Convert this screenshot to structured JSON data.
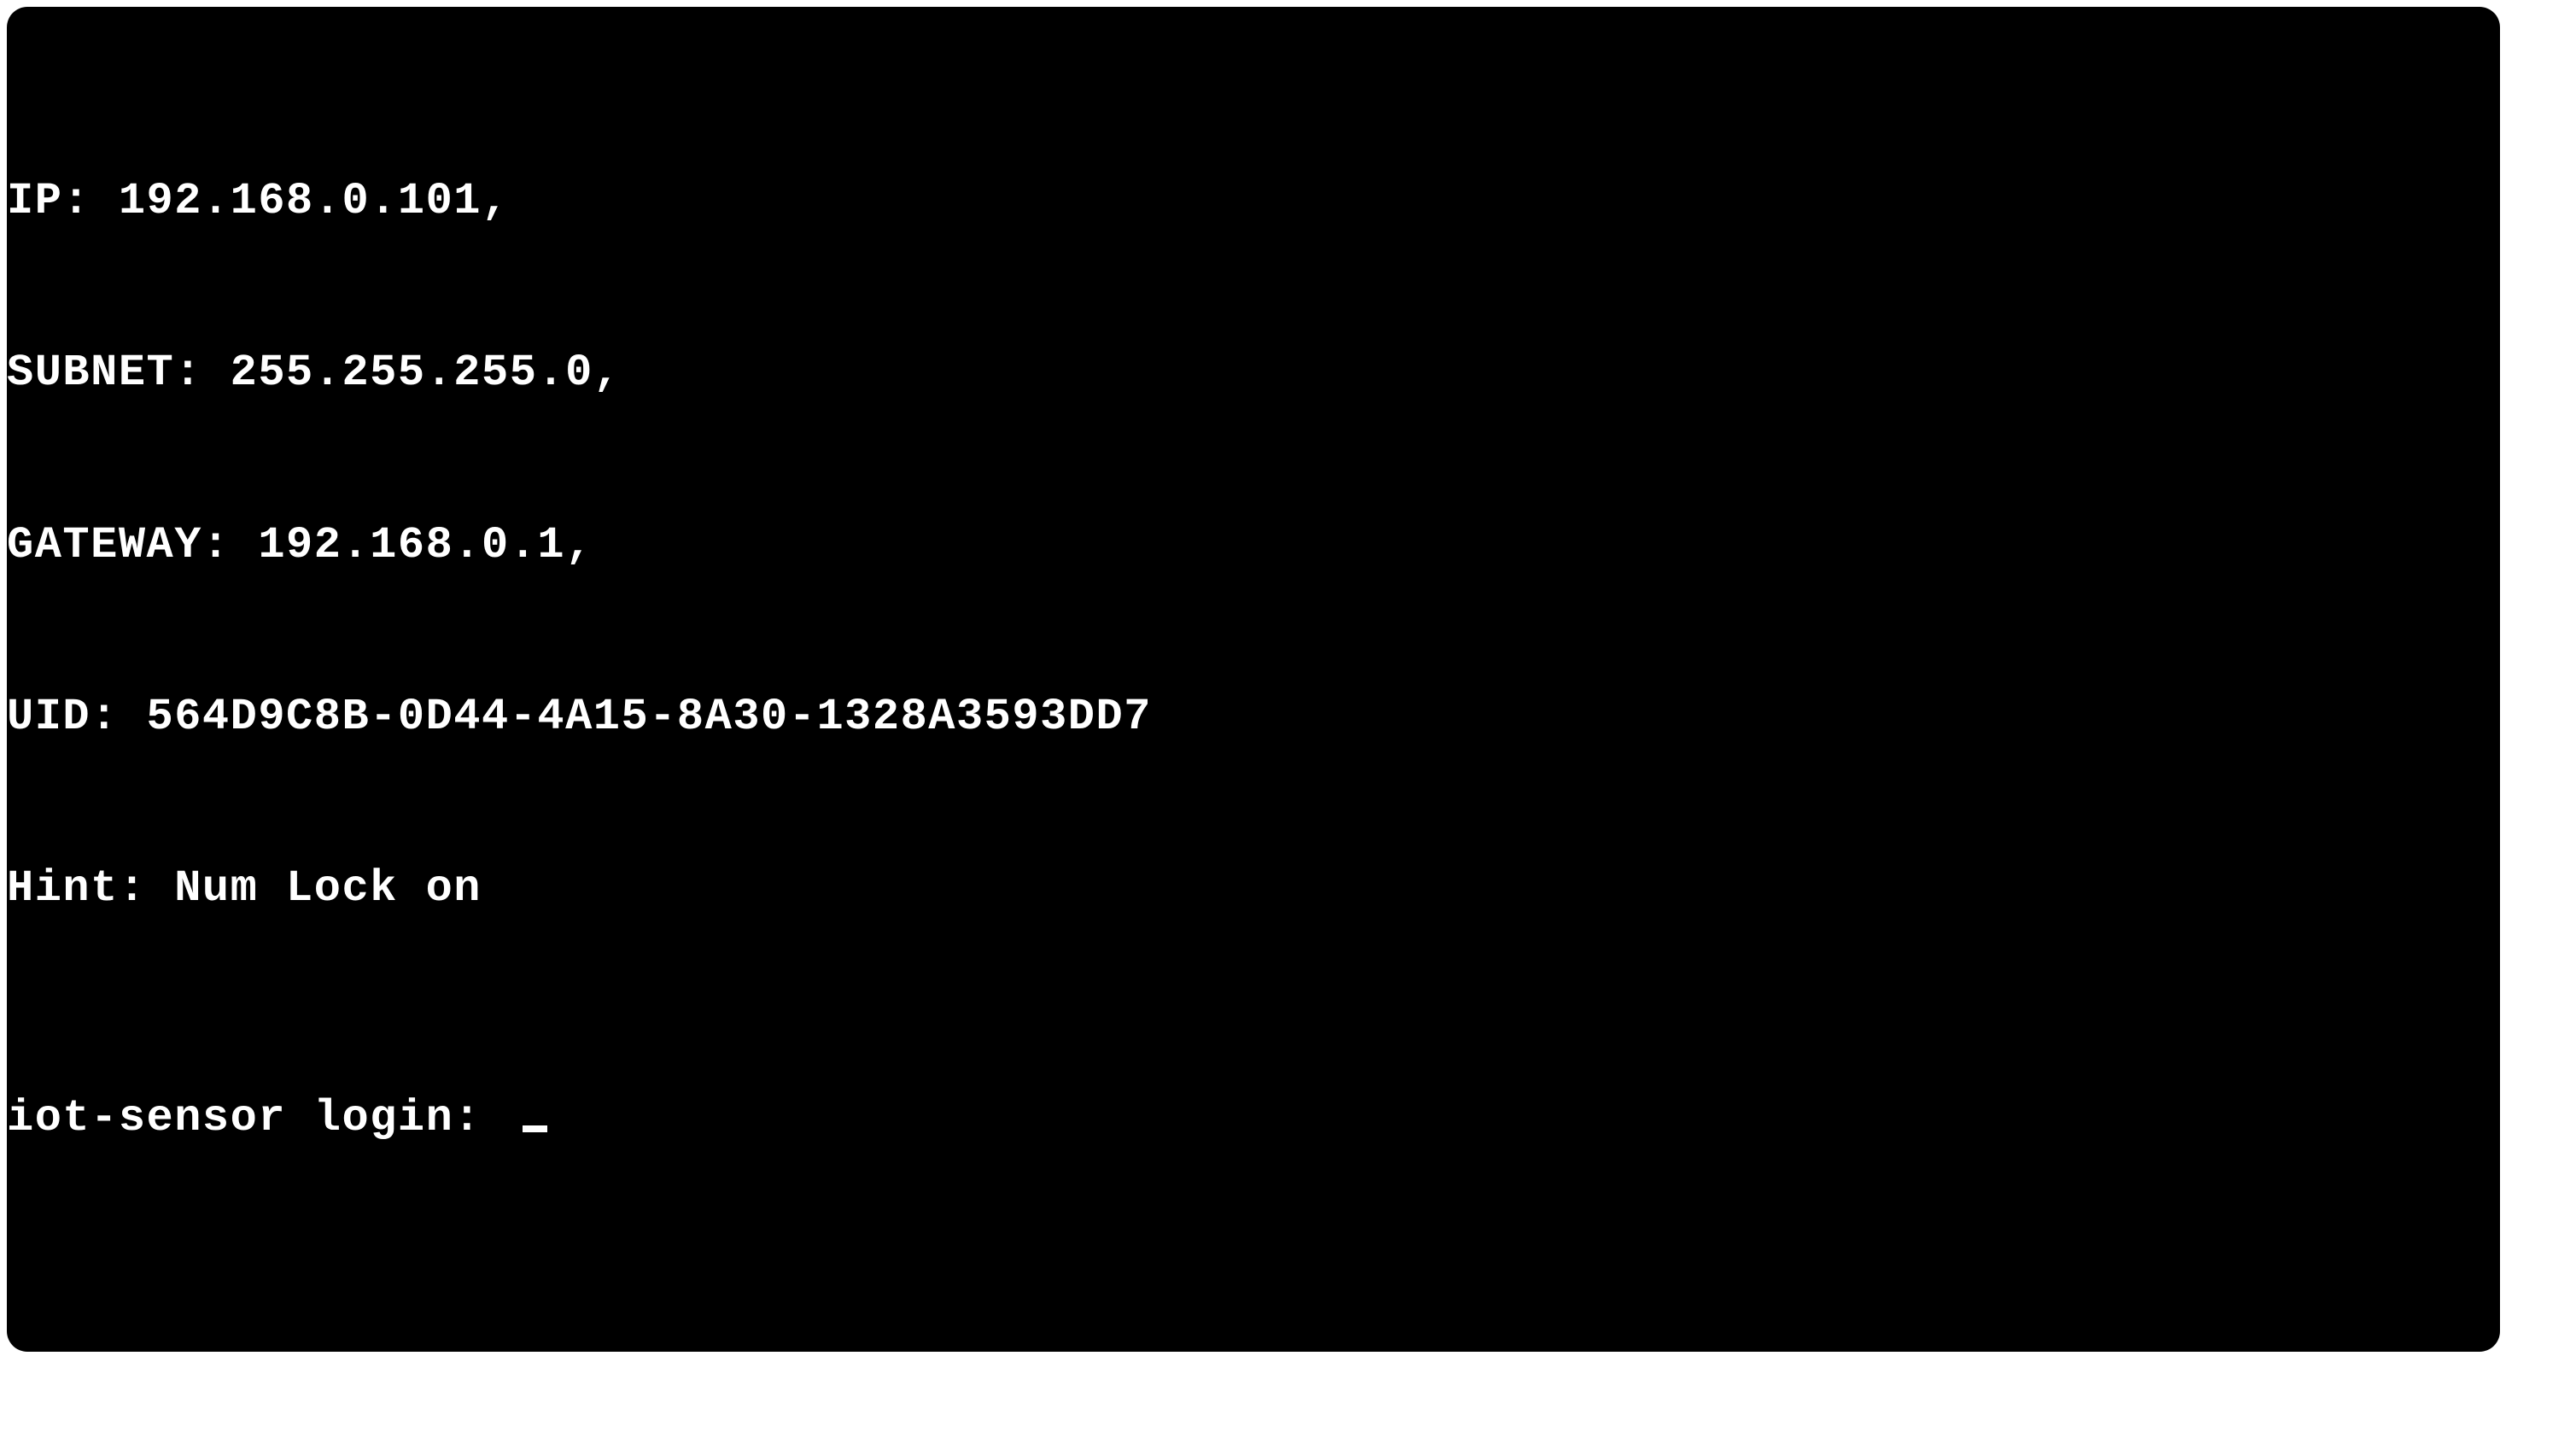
{
  "terminal": {
    "lines": {
      "ip": "IP: 192.168.0.101,",
      "subnet": "SUBNET: 255.255.255.0,",
      "gateway": "GATEWAY: 192.168.0.1,",
      "uid": "UID: 564D9C8B-0D44-4A15-8A30-1328A3593DD7",
      "hint": "Hint: Num Lock on"
    },
    "login_prompt": "iot-sensor login: "
  }
}
